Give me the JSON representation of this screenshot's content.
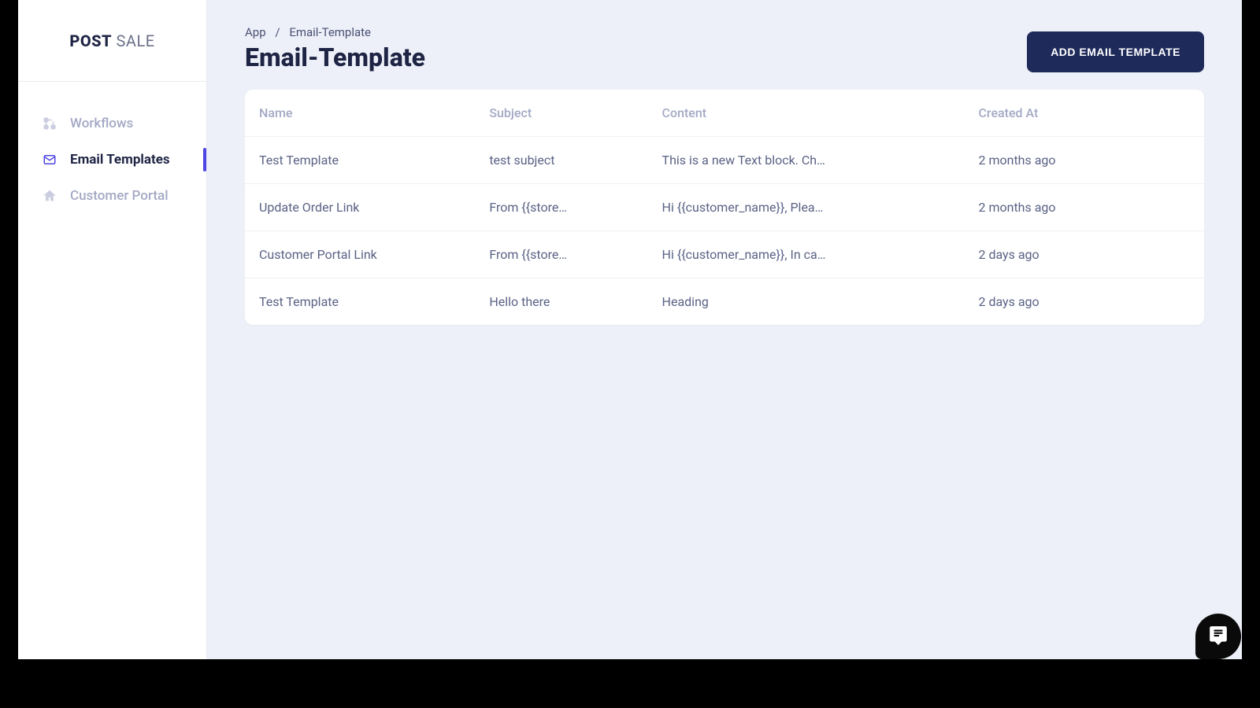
{
  "logo": {
    "bold": "POST",
    "light": " SALE"
  },
  "sidebar": {
    "items": [
      {
        "label": "Workflows",
        "icon": "workflow-icon"
      },
      {
        "label": "Email Templates",
        "icon": "mail-icon"
      },
      {
        "label": "Customer Portal",
        "icon": "home-icon"
      }
    ]
  },
  "breadcrumb": {
    "root": "App",
    "current": "Email-Template"
  },
  "page_title": "Email-Template",
  "actions": {
    "add_label": "ADD EMAIL TEMPLATE"
  },
  "table": {
    "columns": [
      "Name",
      "Subject",
      "Content",
      "Created At"
    ],
    "rows": [
      {
        "name": "Test Template",
        "subject": "test subject",
        "content": "This is a new Text block. Ch…",
        "created_at": "2 months ago"
      },
      {
        "name": "Update Order Link",
        "subject": "From {{store…",
        "content": "Hi {{customer_name}}, Plea…",
        "created_at": "2 months ago"
      },
      {
        "name": "Customer Portal Link",
        "subject": "From {{store…",
        "content": "Hi {{customer_name}}, In ca…",
        "created_at": "2 days ago"
      },
      {
        "name": "Test Template",
        "subject": "Hello there",
        "content": "Heading",
        "created_at": "2 days ago"
      }
    ]
  }
}
